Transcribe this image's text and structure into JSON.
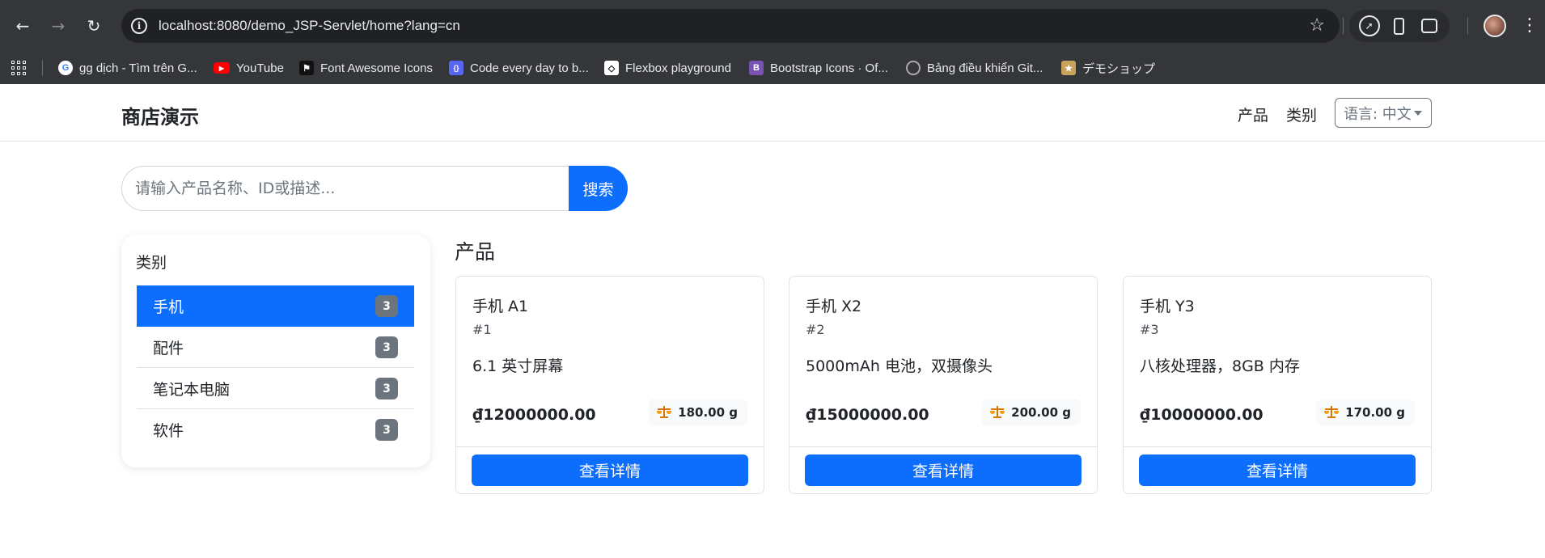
{
  "browser": {
    "url": "localhost:8080/demo_JSP-Servlet/home?lang=cn",
    "bookmarks": [
      {
        "label": "gg dịch - Tìm trên G...",
        "icon": "google-icon"
      },
      {
        "label": "YouTube",
        "icon": "youtube-icon"
      },
      {
        "label": "Font Awesome Icons",
        "icon": "font-awesome-flag-icon"
      },
      {
        "label": "Code every day to b...",
        "icon": "code-icon"
      },
      {
        "label": "Flexbox playground",
        "icon": "codepen-icon"
      },
      {
        "label": "Bootstrap Icons · Of...",
        "icon": "bootstrap-icon"
      },
      {
        "label": "Bảng điều khiển Git...",
        "icon": "github-icon"
      },
      {
        "label": "デモショップ",
        "icon": "shop-icon"
      }
    ]
  },
  "navbar": {
    "brand": "商店演示",
    "links": [
      "产品",
      "类别"
    ],
    "language_select": "语言: 中文"
  },
  "search": {
    "placeholder": "请输入产品名称、ID或描述...",
    "button": "搜索"
  },
  "sidebar": {
    "title": "类别",
    "categories": [
      {
        "name": "手机",
        "count": "3",
        "active": true
      },
      {
        "name": "配件",
        "count": "3",
        "active": false
      },
      {
        "name": "笔记本电脑",
        "count": "3",
        "active": false
      },
      {
        "name": "软件",
        "count": "3",
        "active": false
      }
    ]
  },
  "products": {
    "title": "产品",
    "items": [
      {
        "name": "手机 A1",
        "id": "#1",
        "description": "6.1 英寸屏幕",
        "price": "₫12000000.00",
        "weight": "180.00 g",
        "button": "查看详情"
      },
      {
        "name": "手机 X2",
        "id": "#2",
        "description": "5000mAh 电池，双摄像头",
        "price": "₫15000000.00",
        "weight": "200.00 g",
        "button": "查看详情"
      },
      {
        "name": "手机 Y3",
        "id": "#3",
        "description": "八核处理器，8GB 内存",
        "price": "₫10000000.00",
        "weight": "170.00 g",
        "button": "查看详情"
      }
    ]
  },
  "colors": {
    "primary": "#0d6efd",
    "badge": "#6c757d",
    "chrome_bg": "#35363a",
    "omnibox_bg": "#202124"
  }
}
